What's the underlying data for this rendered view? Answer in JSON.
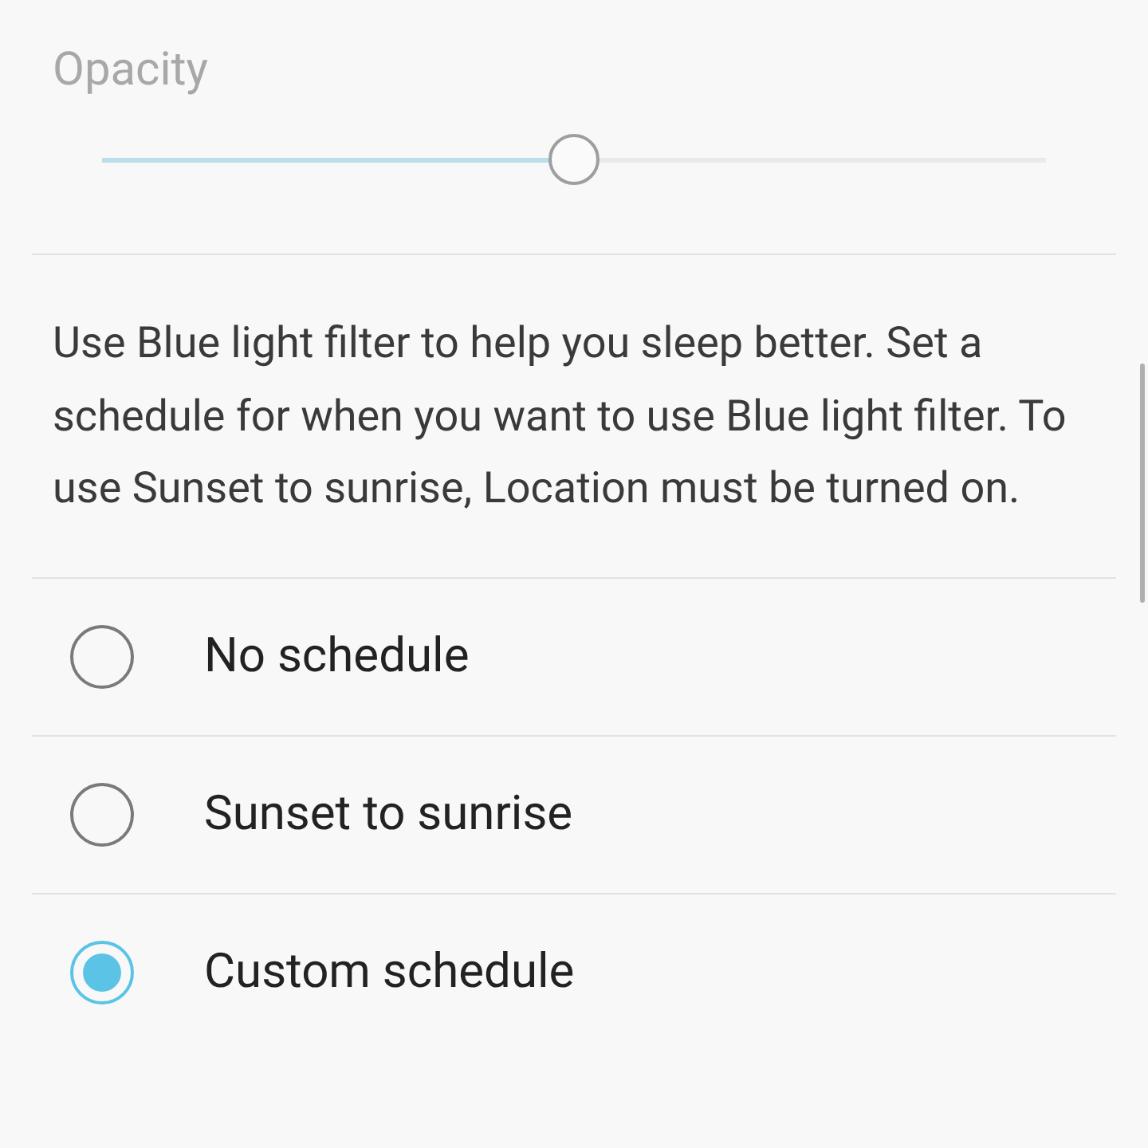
{
  "opacity": {
    "label": "Opacity",
    "level": 0.5
  },
  "description": "Use Blue light filter to help you sleep better. Set a schedule for when you want to use Blue light filter. To use Sunset to sunrise, Location must be turned on.",
  "schedule_options": [
    {
      "label": "No schedule",
      "selected": false
    },
    {
      "label": "Sunset to sunrise",
      "selected": false
    },
    {
      "label": "Custom schedule",
      "selected": true
    }
  ]
}
